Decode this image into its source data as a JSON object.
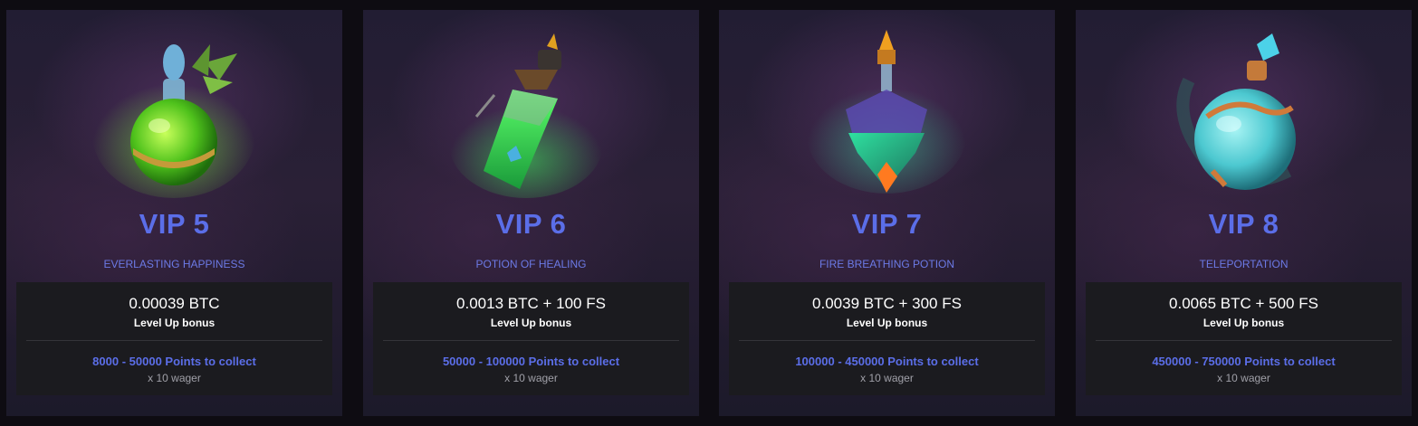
{
  "cards": [
    {
      "title": "VIP 5",
      "name": "EVERLASTING HAPPINESS",
      "reward": "0.00039 BTC",
      "reward_label": "Level Up bonus",
      "points": "8000 - 50000 Points to collect",
      "wager": "x 10 wager",
      "icon": "green-round-potion-icon"
    },
    {
      "title": "VIP 6",
      "name": "POTION OF HEALING",
      "reward": "0.0013 BTC + 100 FS",
      "reward_label": "Level Up bonus",
      "points": "50000 - 100000 Points to collect",
      "wager": "x 10 wager",
      "icon": "green-flask-potion-icon"
    },
    {
      "title": "VIP 7",
      "name": "FIRE BREATHING POTION",
      "reward": "0.0039 BTC + 300 FS",
      "reward_label": "Level Up bonus",
      "points": "100000 - 450000 Points to collect",
      "wager": "x 10 wager",
      "icon": "crystal-potion-icon"
    },
    {
      "title": "VIP 8",
      "name": "TELEPORTATION",
      "reward": "0.0065 BTC + 500 FS",
      "reward_label": "Level Up bonus",
      "points": "450000 - 750000 Points to collect",
      "wager": "x 10 wager",
      "icon": "teal-round-potion-icon"
    }
  ],
  "colors": {
    "accent": "#5b6ee8",
    "panel": "#1b1b1f",
    "card": "#241d33"
  }
}
